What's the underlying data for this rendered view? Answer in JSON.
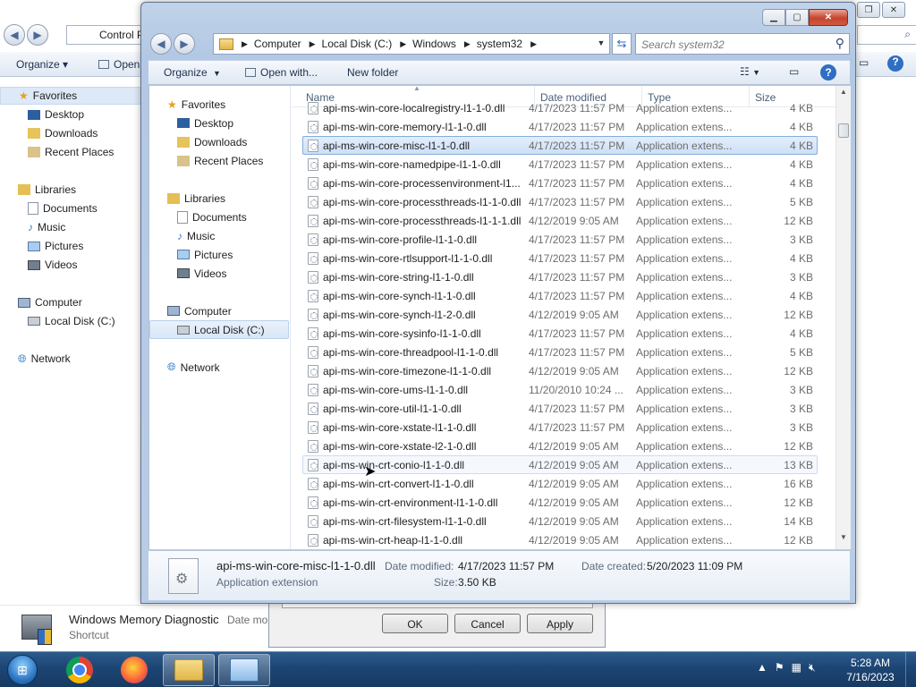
{
  "background_window": {
    "address": "Control P",
    "search_tail": "⌕",
    "toolbar": {
      "organize": "Organize ▾",
      "open": "Open"
    },
    "nav": {
      "favorites": "Favorites",
      "desktop": "Desktop",
      "downloads": "Downloads",
      "recent_places": "Recent Places",
      "libraries": "Libraries",
      "documents": "Documents",
      "music": "Music",
      "pictures": "Pictures",
      "videos": "Videos",
      "computer": "Computer",
      "local_disk": "Local Disk (C:)",
      "network": "Network"
    },
    "status": {
      "name": "Windows Memory Diagnostic",
      "date": "Date mo",
      "type": "Shortcut"
    }
  },
  "properties_dialog": {
    "ok": "OK",
    "cancel": "Cancel",
    "apply": "Apply"
  },
  "explorer": {
    "breadcrumb": [
      "Computer",
      "Local Disk (C:)",
      "Windows",
      "system32"
    ],
    "search_placeholder": "Search system32",
    "toolbar": {
      "organize": "Organize",
      "open_with": "Open with...",
      "new_folder": "New folder"
    },
    "nav": {
      "favorites": "Favorites",
      "desktop": "Desktop",
      "downloads": "Downloads",
      "recent_places": "Recent Places",
      "libraries": "Libraries",
      "documents": "Documents",
      "music": "Music",
      "pictures": "Pictures",
      "videos": "Videos",
      "computer": "Computer",
      "local_disk": "Local Disk (C:)",
      "network": "Network"
    },
    "columns": {
      "name": "Name",
      "date": "Date modified",
      "type": "Type",
      "size": "Size"
    },
    "files": [
      {
        "name": "api-ms-win-core-localregistry-l1-1-0.dll",
        "date": "4/17/2023 11:57 PM",
        "type": "Application extens...",
        "size": "4 KB"
      },
      {
        "name": "api-ms-win-core-memory-l1-1-0.dll",
        "date": "4/17/2023 11:57 PM",
        "type": "Application extens...",
        "size": "4 KB"
      },
      {
        "name": "api-ms-win-core-misc-l1-1-0.dll",
        "date": "4/17/2023 11:57 PM",
        "type": "Application extens...",
        "size": "4 KB"
      },
      {
        "name": "api-ms-win-core-namedpipe-l1-1-0.dll",
        "date": "4/17/2023 11:57 PM",
        "type": "Application extens...",
        "size": "4 KB"
      },
      {
        "name": "api-ms-win-core-processenvironment-l1...",
        "date": "4/17/2023 11:57 PM",
        "type": "Application extens...",
        "size": "4 KB"
      },
      {
        "name": "api-ms-win-core-processthreads-l1-1-0.dll",
        "date": "4/17/2023 11:57 PM",
        "type": "Application extens...",
        "size": "5 KB"
      },
      {
        "name": "api-ms-win-core-processthreads-l1-1-1.dll",
        "date": "4/12/2019 9:05 AM",
        "type": "Application extens...",
        "size": "12 KB"
      },
      {
        "name": "api-ms-win-core-profile-l1-1-0.dll",
        "date": "4/17/2023 11:57 PM",
        "type": "Application extens...",
        "size": "3 KB"
      },
      {
        "name": "api-ms-win-core-rtlsupport-l1-1-0.dll",
        "date": "4/17/2023 11:57 PM",
        "type": "Application extens...",
        "size": "4 KB"
      },
      {
        "name": "api-ms-win-core-string-l1-1-0.dll",
        "date": "4/17/2023 11:57 PM",
        "type": "Application extens...",
        "size": "3 KB"
      },
      {
        "name": "api-ms-win-core-synch-l1-1-0.dll",
        "date": "4/17/2023 11:57 PM",
        "type": "Application extens...",
        "size": "4 KB"
      },
      {
        "name": "api-ms-win-core-synch-l1-2-0.dll",
        "date": "4/12/2019 9:05 AM",
        "type": "Application extens...",
        "size": "12 KB"
      },
      {
        "name": "api-ms-win-core-sysinfo-l1-1-0.dll",
        "date": "4/17/2023 11:57 PM",
        "type": "Application extens...",
        "size": "4 KB"
      },
      {
        "name": "api-ms-win-core-threadpool-l1-1-0.dll",
        "date": "4/17/2023 11:57 PM",
        "type": "Application extens...",
        "size": "5 KB"
      },
      {
        "name": "api-ms-win-core-timezone-l1-1-0.dll",
        "date": "4/12/2019 9:05 AM",
        "type": "Application extens...",
        "size": "12 KB"
      },
      {
        "name": "api-ms-win-core-ums-l1-1-0.dll",
        "date": "11/20/2010 10:24 ...",
        "type": "Application extens...",
        "size": "3 KB"
      },
      {
        "name": "api-ms-win-core-util-l1-1-0.dll",
        "date": "4/17/2023 11:57 PM",
        "type": "Application extens...",
        "size": "3 KB"
      },
      {
        "name": "api-ms-win-core-xstate-l1-1-0.dll",
        "date": "4/17/2023 11:57 PM",
        "type": "Application extens...",
        "size": "3 KB"
      },
      {
        "name": "api-ms-win-core-xstate-l2-1-0.dll",
        "date": "4/12/2019 9:05 AM",
        "type": "Application extens...",
        "size": "12 KB"
      },
      {
        "name": "api-ms-win-crt-conio-l1-1-0.dll",
        "date": "4/12/2019 9:05 AM",
        "type": "Application extens...",
        "size": "13 KB"
      },
      {
        "name": "api-ms-win-crt-convert-l1-1-0.dll",
        "date": "4/12/2019 9:05 AM",
        "type": "Application extens...",
        "size": "16 KB"
      },
      {
        "name": "api-ms-win-crt-environment-l1-1-0.dll",
        "date": "4/12/2019 9:05 AM",
        "type": "Application extens...",
        "size": "12 KB"
      },
      {
        "name": "api-ms-win-crt-filesystem-l1-1-0.dll",
        "date": "4/12/2019 9:05 AM",
        "type": "Application extens...",
        "size": "14 KB"
      },
      {
        "name": "api-ms-win-crt-heap-l1-1-0.dll",
        "date": "4/12/2019 9:05 AM",
        "type": "Application extens...",
        "size": "12 KB"
      }
    ],
    "selected_index": 2,
    "hover_index": 19,
    "details": {
      "name": "api-ms-win-core-misc-l1-1-0.dll",
      "type": "Application extension",
      "date_modified_label": "Date modified:",
      "date_modified": "4/17/2023 11:57 PM",
      "date_created_label": "Date created:",
      "date_created": "5/20/2023 11:09 PM",
      "size_label": "Size:",
      "size": "3.50 KB"
    }
  },
  "taskbar": {
    "time": "5:28 AM",
    "date": "7/16/2023"
  },
  "colors": {
    "selection": "#cde0f6",
    "taskbar": "#1d4573",
    "window_frame": "#b9cce6"
  }
}
